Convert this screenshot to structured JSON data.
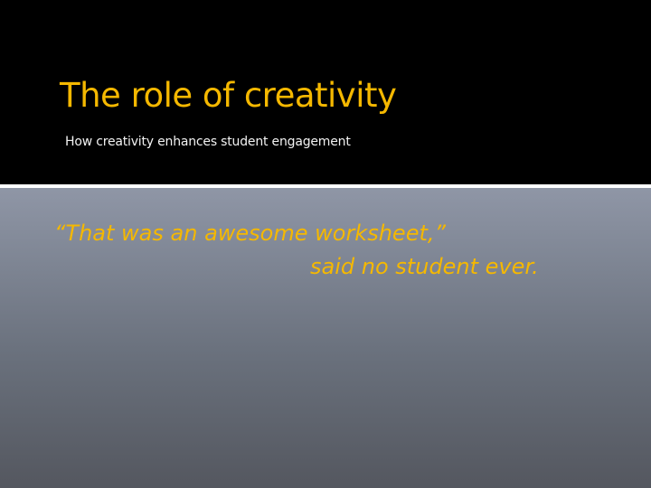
{
  "slide": {
    "title": "The role of creativity",
    "subtitle": "How creativity enhances student engagement",
    "quote": {
      "line_1": "“That was an awesome worksheet,”",
      "line_2": "said no student ever."
    }
  },
  "colors": {
    "title_band": "#000000",
    "accent_text": "#f5b800",
    "subtitle_text": "#f2f2f2",
    "divider": "#ffffff",
    "content_gradient_top": "#8f96a6",
    "content_gradient_bottom": "#54575f"
  }
}
